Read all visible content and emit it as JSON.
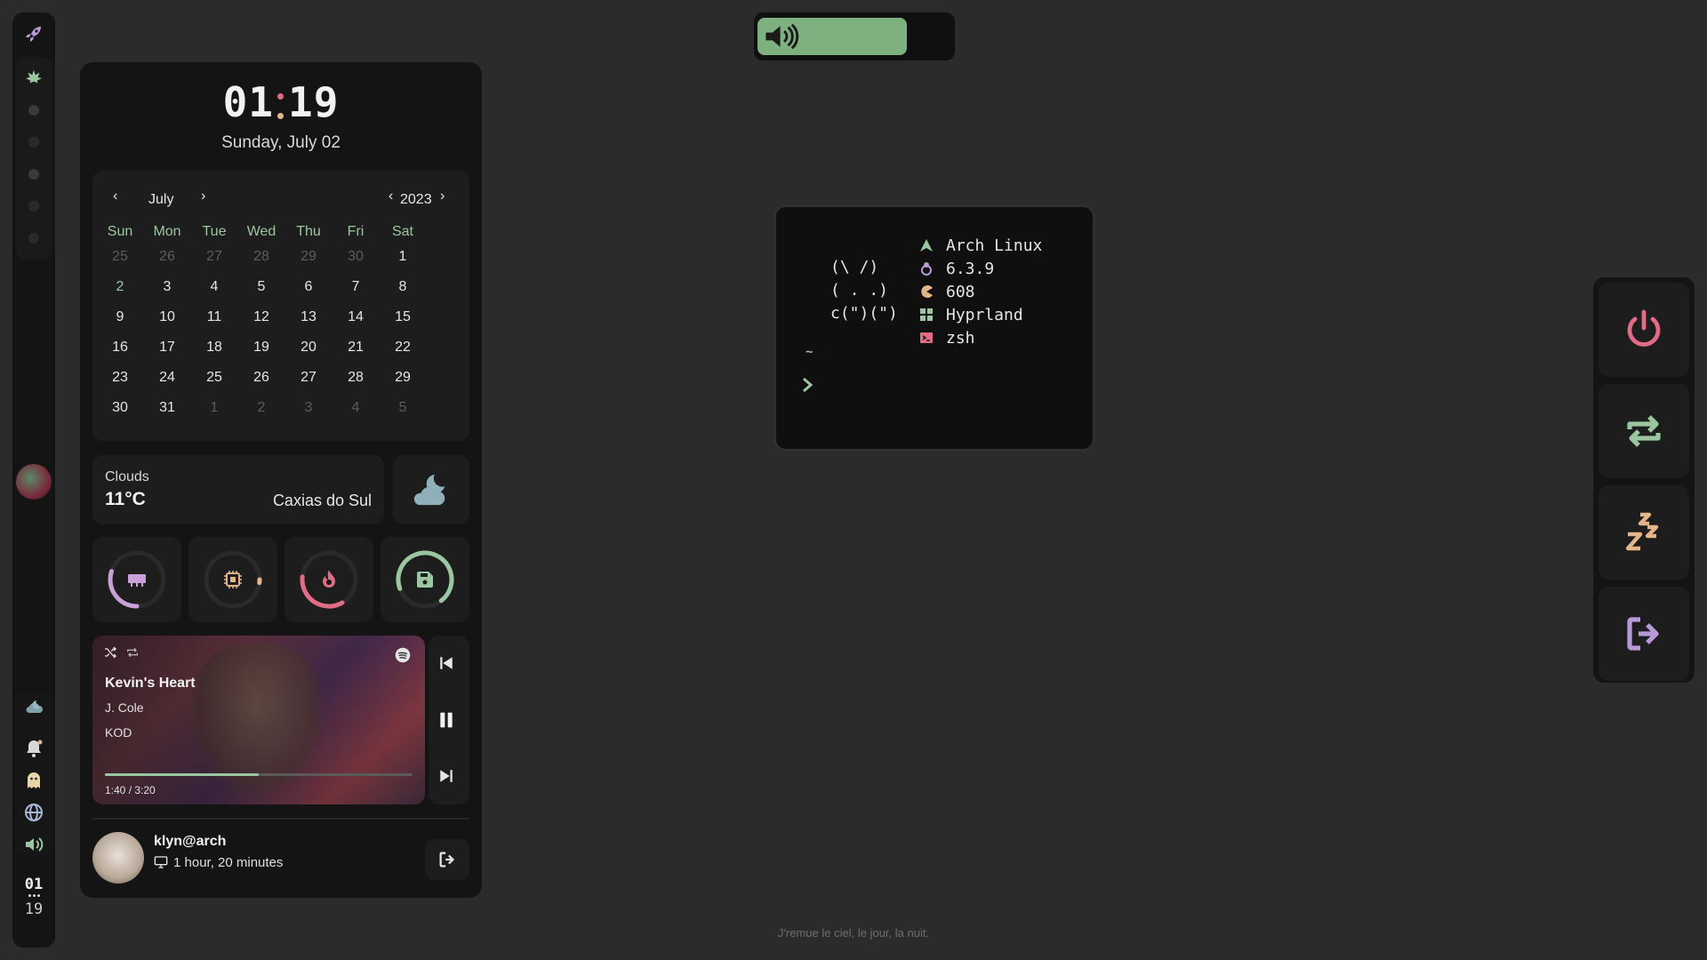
{
  "colors": {
    "accent_green": "#9bc7a0",
    "accent_pink": "#e06c85",
    "accent_purple": "#b89ad8",
    "accent_peach": "#e5b58a",
    "bg": "#2b2b2b",
    "panel": "#141414"
  },
  "left_bar": {
    "top_icon": "rocket-icon",
    "workspace_icon": "leaf-icon",
    "bottom_icons": [
      "weather-icon",
      "notification-bell-icon",
      "ghost-icon",
      "globe-icon",
      "volume-icon"
    ],
    "clock_hours": "01",
    "clock_minutes": "19"
  },
  "dashboard": {
    "clock": {
      "hours": "01",
      "minutes": "19"
    },
    "date": "Sunday, July 02",
    "calendar": {
      "month": "July",
      "year": "2023",
      "weekdays": [
        "Sun",
        "Mon",
        "Tue",
        "Wed",
        "Thu",
        "Fri",
        "Sat"
      ],
      "weeks": [
        [
          "25",
          "26",
          "27",
          "28",
          "29",
          "30",
          "1"
        ],
        [
          "2",
          "3",
          "4",
          "5",
          "6",
          "7",
          "8"
        ],
        [
          "9",
          "10",
          "11",
          "12",
          "13",
          "14",
          "15"
        ],
        [
          "16",
          "17",
          "18",
          "19",
          "20",
          "21",
          "22"
        ],
        [
          "23",
          "24",
          "25",
          "26",
          "27",
          "28",
          "29"
        ],
        [
          "30",
          "31",
          "1",
          "2",
          "3",
          "4",
          "5"
        ]
      ],
      "selected_day": "2"
    },
    "weather": {
      "condition": "Clouds",
      "temperature": "11°C",
      "location": "Caxias do Sul",
      "icon": "cloud-moon-icon"
    },
    "gauges": [
      {
        "name": "ram",
        "icon": "memory-icon",
        "level": 0.3,
        "color": "#c9a0d8"
      },
      {
        "name": "cpu",
        "icon": "cpu-icon",
        "level": 0.02,
        "color": "#e5b58a"
      },
      {
        "name": "temperature",
        "icon": "flame-icon",
        "level": 0.35,
        "color": "#e06c85"
      },
      {
        "name": "disk",
        "icon": "disk-icon",
        "level": 0.7,
        "color": "#9bc7a0"
      }
    ],
    "music": {
      "title": "Kevin's Heart",
      "artist": "J. Cole",
      "album": "KOD",
      "time": "1:40 / 3:20",
      "progress": 0.5
    },
    "user": {
      "name": "klyn@arch",
      "uptime": "1 hour, 20 minutes"
    }
  },
  "volume_osd": {
    "level": 0.75
  },
  "terminal": {
    "ascii": [
      "(\\ /)",
      "( . .)",
      "c(\")(\")"
    ],
    "info": [
      {
        "icon": "arch-icon",
        "text": "Arch Linux",
        "color": "#9bc7a0"
      },
      {
        "icon": "linux-icon",
        "text": "6.3.9",
        "color": "#b89ad8"
      },
      {
        "icon": "pacman-icon",
        "text": "608",
        "color": "#e5b58a"
      },
      {
        "icon": "windows-grid-icon",
        "text": "Hyprland",
        "color": "#9bc7a0"
      },
      {
        "icon": "terminal-icon",
        "text": "zsh",
        "color": "#e06c85"
      }
    ],
    "cwd": "~"
  },
  "power_menu": [
    {
      "name": "shutdown",
      "icon": "power-icon",
      "color": "#e06c85"
    },
    {
      "name": "reboot",
      "icon": "reboot-icon",
      "color": "#9bc7a0"
    },
    {
      "name": "suspend",
      "icon": "sleep-icon",
      "color": "#e5b58a"
    },
    {
      "name": "logout",
      "icon": "logout-icon",
      "color": "#b89ad8"
    }
  ],
  "footer_quote": "J'remue le ciel, le jour, la nuit."
}
